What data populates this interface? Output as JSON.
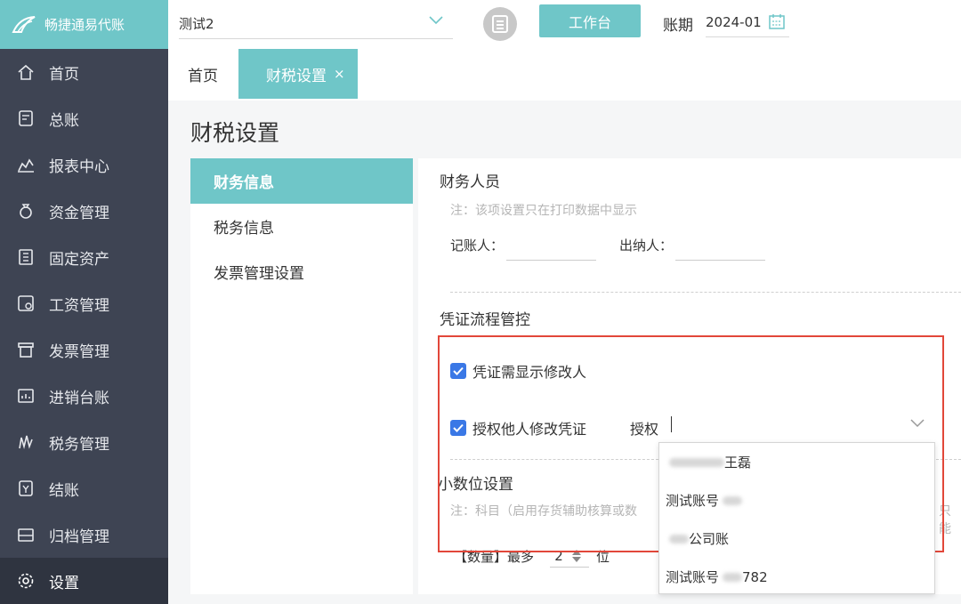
{
  "app": {
    "name": "畅捷通易代账"
  },
  "sidebar": {
    "items": [
      {
        "label": "首页",
        "icon": "home-icon"
      },
      {
        "label": "总账",
        "icon": "ledger-icon"
      },
      {
        "label": "报表中心",
        "icon": "chart-icon"
      },
      {
        "label": "资金管理",
        "icon": "money-bag-icon"
      },
      {
        "label": "固定资产",
        "icon": "building-icon"
      },
      {
        "label": "工资管理",
        "icon": "salary-icon"
      },
      {
        "label": "发票管理",
        "icon": "invoice-icon"
      },
      {
        "label": "进销台账",
        "icon": "inventory-icon"
      },
      {
        "label": "税务管理",
        "icon": "tax-icon"
      },
      {
        "label": "结账",
        "icon": "checkout-icon"
      },
      {
        "label": "归档管理",
        "icon": "archive-icon"
      },
      {
        "label": "设置",
        "icon": "gear-icon"
      }
    ],
    "active_index": 11
  },
  "topbar": {
    "company": "测试2",
    "workbench_label": "工作台",
    "period_label": "账期",
    "period_value": "2024-01"
  },
  "tabs": {
    "home": "首页",
    "active": "财税设置",
    "close_glyph": "×"
  },
  "page": {
    "title": "财税设置"
  },
  "subnav": {
    "items": [
      "财务信息",
      "税务信息",
      "发票管理设置"
    ],
    "active_index": 0
  },
  "finance_staff": {
    "title": "财务人员",
    "note": "注：该项设置只在打印数据中显示",
    "bookkeeper_label": "记账人：",
    "cashier_label": "出纳人："
  },
  "voucher_control": {
    "title": "凭证流程管控",
    "show_modifier_label": "凭证需显示修改人",
    "show_modifier_checked": true,
    "authorize_others_label": "授权他人修改凭证",
    "authorize_others_checked": true,
    "auth_label": "授权"
  },
  "auth_dropdown": {
    "options": [
      {
        "prefix": "",
        "suffix": "王磊"
      },
      {
        "prefix": "测试账号",
        "suffix": ""
      },
      {
        "prefix": "",
        "suffix": "公司账"
      },
      {
        "prefix": "测试账号",
        "suffix": "782"
      }
    ]
  },
  "decimal": {
    "title": "小数位设置",
    "note": "注：科目（启用存货辅助核算或数",
    "note_tail": "只能",
    "quantity_label": "【数量】最多",
    "quantity_value": "2",
    "unit": "位"
  },
  "colors": {
    "accent": "#6fc6c8",
    "sidebar_bg": "#3e4453",
    "checkbox": "#3a78e6",
    "highlight_border": "#e2473a"
  }
}
